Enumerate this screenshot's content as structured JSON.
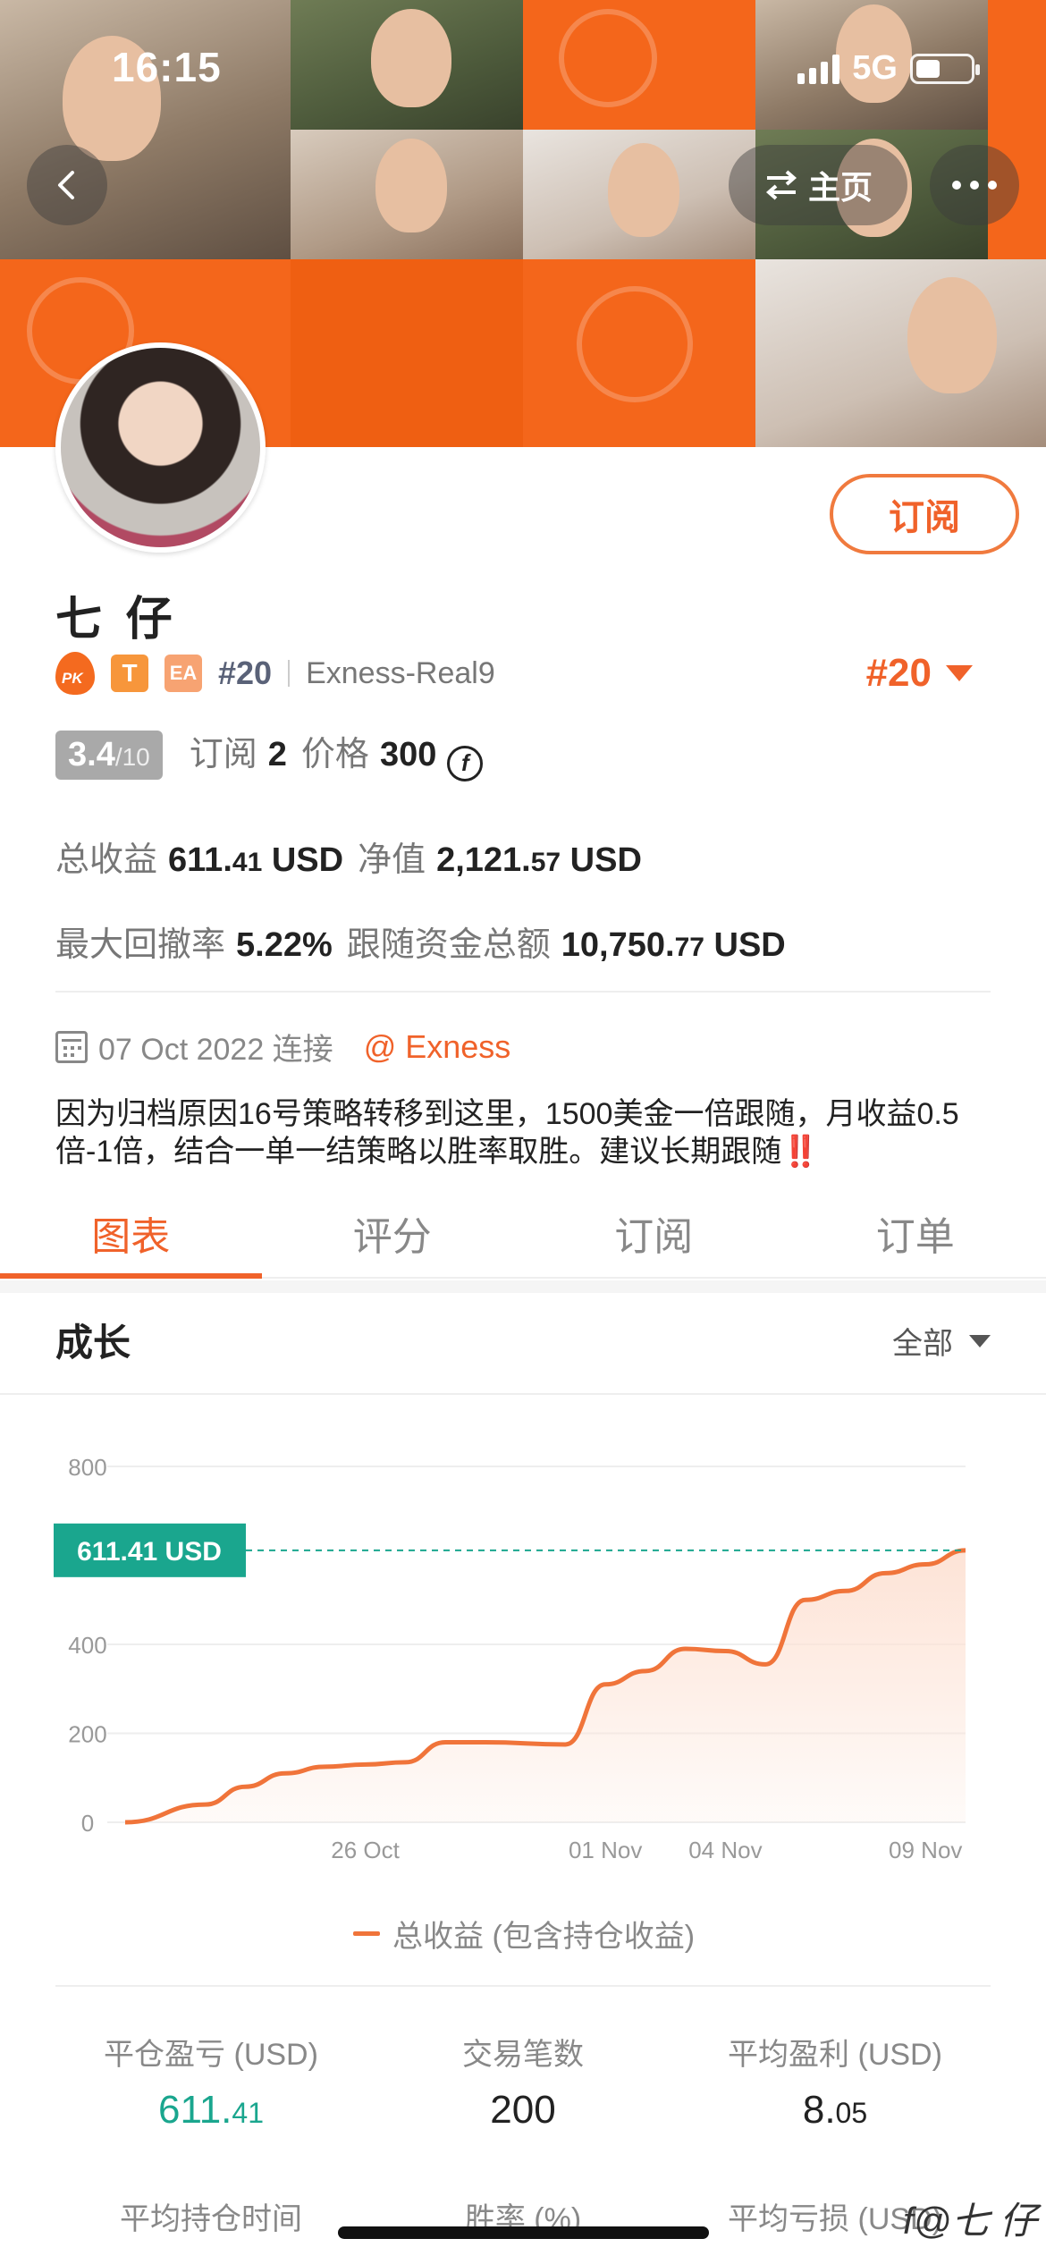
{
  "status_bar": {
    "time": "16:15",
    "network": "5G"
  },
  "nav": {
    "home_label": "主页"
  },
  "profile": {
    "name": "七 仔",
    "subscribe_label": "订阅",
    "badges": {
      "pk": "PK",
      "t": "T",
      "ea": "EA"
    },
    "rank_small": "#20",
    "server": "Exness-Real9",
    "rank_big": "#20"
  },
  "metrics": {
    "score": "3.4",
    "score_max": "/10",
    "subscribe_label": "订阅",
    "subscribe_count": "2",
    "price_label": "价格",
    "price_value": "300",
    "price_icon_glyph": "f",
    "total_profit_label": "总收益",
    "total_profit_main": "611.",
    "total_profit_cents": "41",
    "total_profit_unit": " USD",
    "equity_label": "净值",
    "equity_main": "2,121.",
    "equity_cents": "57",
    "equity_unit": " USD",
    "max_drawdown_label": "最大回撤率",
    "max_drawdown_value": "5.22%",
    "follow_total_label": "跟随资金总额",
    "follow_total_main": "10,750.",
    "follow_total_cents": "77",
    "follow_total_unit": " USD"
  },
  "connect": {
    "date_text": "07 Oct 2022 连接",
    "broker": "@ Exness"
  },
  "description": {
    "text": "因为归档原因16号策略转移到这里，1500美金一倍跟随，月收益0.5倍-1倍，结合一单一结策略以胜率取胜。建议长期跟随",
    "emphasis": "‼️"
  },
  "tabs": [
    "图表",
    "评分",
    "订阅",
    "订单"
  ],
  "growth": {
    "title": "成长",
    "filter": "全部"
  },
  "chart_data": {
    "type": "area",
    "title": "",
    "xlabel": "",
    "ylabel": "",
    "ylim": [
      0,
      800
    ],
    "y_ticks": [
      "0",
      "200",
      "400",
      "800"
    ],
    "x_ticks": [
      "26 Oct",
      "01 Nov",
      "04 Nov",
      "09 Nov"
    ],
    "current_label": "611.41 USD",
    "current_value": 611.41,
    "legend": "总收益 (包含持仓收益)",
    "colors": {
      "line": "#f0743a",
      "fill": "#fde3d6",
      "marker": "#1aa68e"
    },
    "series": [
      {
        "name": "总收益 (包含持仓收益)",
        "x": [
          "20 Oct",
          "22 Oct",
          "23 Oct",
          "24 Oct",
          "25 Oct",
          "26 Oct",
          "27 Oct",
          "28 Oct",
          "29 Oct",
          "31 Oct",
          "01 Nov",
          "02 Nov",
          "03 Nov",
          "04 Nov",
          "05 Nov",
          "06 Nov",
          "07 Nov",
          "08 Nov",
          "09 Nov",
          "10 Nov"
        ],
        "values": [
          0,
          40,
          80,
          110,
          125,
          130,
          135,
          180,
          180,
          175,
          310,
          340,
          390,
          385,
          355,
          500,
          520,
          560,
          580,
          611.41
        ]
      }
    ]
  },
  "stats": [
    {
      "label": "平仓盈亏 (USD)",
      "main": "611.",
      "cents": "41",
      "green": true
    },
    {
      "label": "交易笔数",
      "main": "200",
      "cents": "",
      "green": false
    },
    {
      "label": "平均盈利 (USD)",
      "main": "8.",
      "cents": "05",
      "green": false
    },
    {
      "label": "平均持仓时间"
    },
    {
      "label": "胜率 (%)"
    },
    {
      "label": "平均亏损 (USD)"
    }
  ],
  "watermark": "f@七 仔"
}
